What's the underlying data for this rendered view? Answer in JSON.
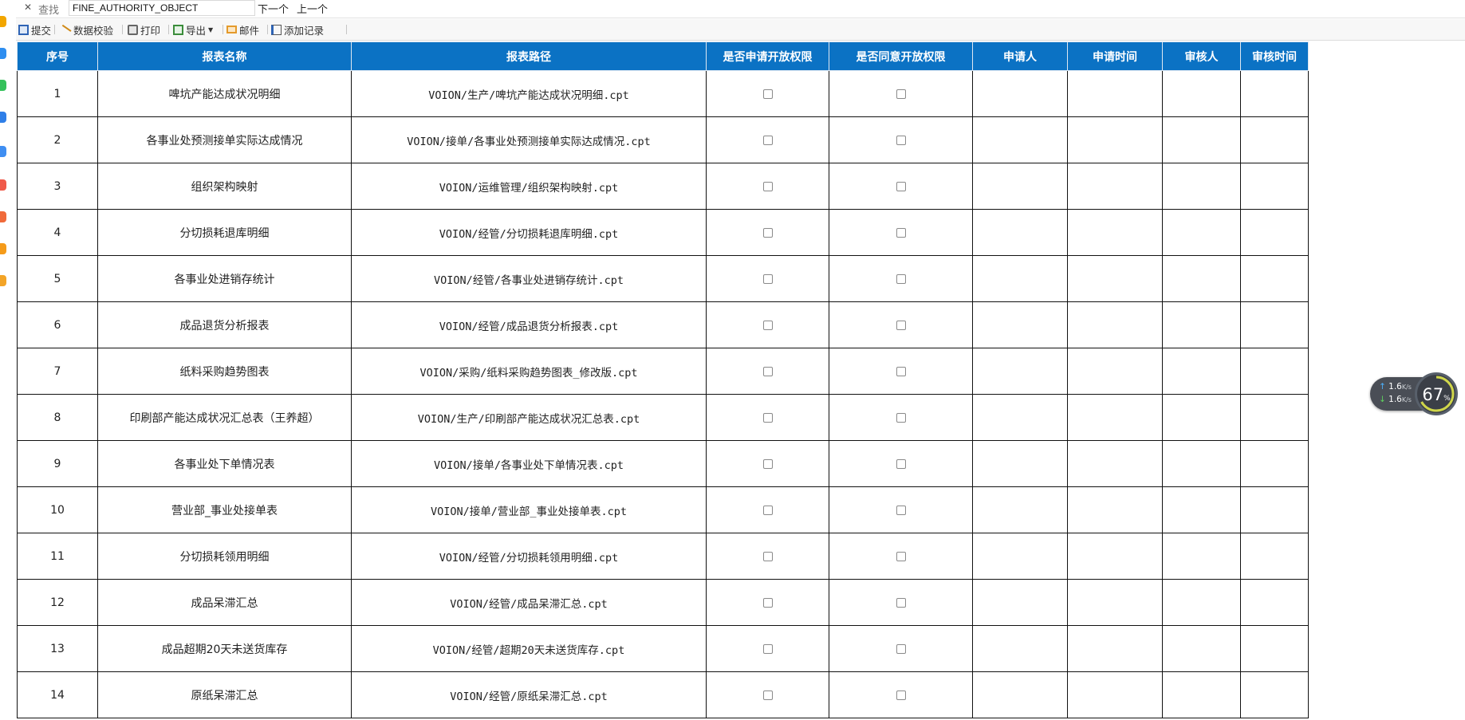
{
  "findbar": {
    "close_icon": "close-icon",
    "label": "查找",
    "value": "FINE_AUTHORITY_OBJECT",
    "next_label": "下一个",
    "prev_label": "上一个"
  },
  "toolbar": {
    "submit": "提交",
    "validate": "数据校验",
    "print": "打印",
    "export": "导出",
    "email": "邮件",
    "add_record": "添加记录"
  },
  "table": {
    "headers": [
      "序号",
      "报表名称",
      "报表路径",
      "是否申请开放权限",
      "是否同意开放权限",
      "申请人",
      "申请时间",
      "审核人",
      "审核时间"
    ],
    "rows": [
      {
        "no": "1",
        "name": "啤坑产能达成状况明细",
        "path": "VOION/生产/啤坑产能达成状况明细.cpt"
      },
      {
        "no": "2",
        "name": "各事业处预测接单实际达成情况",
        "path": "VOION/接单/各事业处预测接单实际达成情况.cpt"
      },
      {
        "no": "3",
        "name": "组织架构映射",
        "path": "VOION/运维管理/组织架构映射.cpt"
      },
      {
        "no": "4",
        "name": "分切损耗退库明细",
        "path": "VOION/经管/分切损耗退库明细.cpt"
      },
      {
        "no": "5",
        "name": "各事业处进销存统计",
        "path": "VOION/经管/各事业处进销存统计.cpt"
      },
      {
        "no": "6",
        "name": "成品退货分析报表",
        "path": "VOION/经管/成品退货分析报表.cpt"
      },
      {
        "no": "7",
        "name": "纸料采购趋势图表",
        "path": "VOION/采购/纸料采购趋势图表_修改版.cpt"
      },
      {
        "no": "8",
        "name": "印刷部产能达成状况汇总表（王养超）",
        "path": "VOION/生产/印刷部产能达成状况汇总表.cpt"
      },
      {
        "no": "9",
        "name": "各事业处下单情况表",
        "path": "VOION/接单/各事业处下单情况表.cpt"
      },
      {
        "no": "10",
        "name": "营业部_事业处接单表",
        "path": "VOION/接单/营业部_事业处接单表.cpt"
      },
      {
        "no": "11",
        "name": "分切损耗领用明细",
        "path": "VOION/经管/分切损耗领用明细.cpt"
      },
      {
        "no": "12",
        "name": "成品呆滞汇总",
        "path": "VOION/经管/成品呆滞汇总.cpt"
      },
      {
        "no": "13",
        "name": "成品超期20天未送货库存",
        "path": "VOION/经管/超期20天未送货库存.cpt"
      },
      {
        "no": "14",
        "name": "原纸呆滞汇总",
        "path": "VOION/经管/原纸呆滞汇总.cpt"
      }
    ]
  },
  "net_widget": {
    "upload": "1.6",
    "download": "1.6",
    "unit": "K/s",
    "percent": "67",
    "percent_sign": "%"
  },
  "colors": {
    "header_bg": "#0b72c4",
    "header_text": "#ffffff",
    "grid_line": "#111111"
  }
}
